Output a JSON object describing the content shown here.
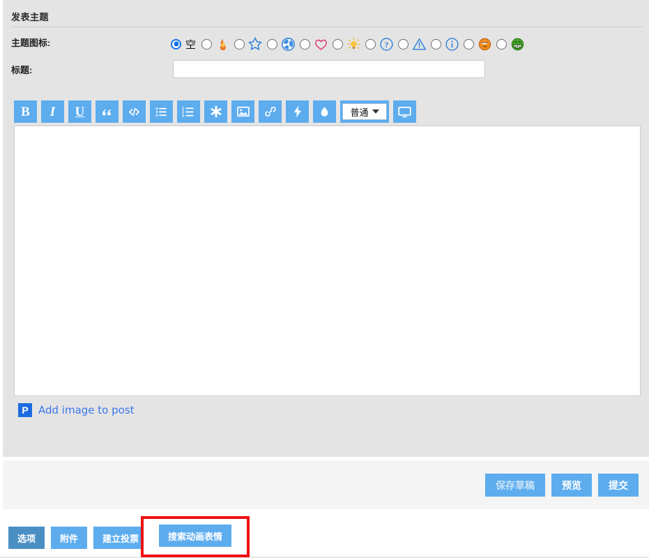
{
  "panel": {
    "title": "发表主题"
  },
  "fields": {
    "icon_label": "主题图标:",
    "title_label": "标题:",
    "title_value": "",
    "title_placeholder": ""
  },
  "topic_icons": [
    {
      "name": "none",
      "glyph": "空",
      "selected": true
    },
    {
      "name": "flame",
      "glyph": "flame-icon",
      "selected": false
    },
    {
      "name": "star",
      "glyph": "star-icon",
      "selected": false
    },
    {
      "name": "radioactive",
      "glyph": "radioactive-icon",
      "selected": false
    },
    {
      "name": "heart",
      "glyph": "heart-icon",
      "selected": false
    },
    {
      "name": "lightbulb",
      "glyph": "lightbulb-icon",
      "selected": false
    },
    {
      "name": "question",
      "glyph": "question-icon",
      "selected": false
    },
    {
      "name": "warning",
      "glyph": "warning-icon",
      "selected": false
    },
    {
      "name": "info",
      "glyph": "info-icon",
      "selected": false
    },
    {
      "name": "smiley-orange",
      "glyph": "smiley-orange-icon",
      "selected": false
    },
    {
      "name": "grin-green",
      "glyph": "grin-green-icon",
      "selected": false
    }
  ],
  "toolbar": {
    "buttons": [
      {
        "name": "bold",
        "label": "B",
        "style": "serif"
      },
      {
        "name": "italic",
        "label": "I",
        "style": "serif-i"
      },
      {
        "name": "underline",
        "label": "U",
        "style": "serif-u"
      },
      {
        "name": "quote",
        "label": "quote-icon",
        "style": "svg"
      },
      {
        "name": "code",
        "label": "code-icon",
        "style": "svg"
      },
      {
        "name": "bullet-list",
        "label": "bullet-list-icon",
        "style": "svg"
      },
      {
        "name": "numbered-list",
        "label": "numbered-list-icon",
        "style": "svg"
      },
      {
        "name": "asterisk",
        "label": "asterisk-icon",
        "style": "svg"
      },
      {
        "name": "image",
        "label": "image-icon",
        "style": "svg"
      },
      {
        "name": "link",
        "label": "link-icon",
        "style": "svg"
      },
      {
        "name": "lightning",
        "label": "lightning-icon",
        "style": "svg"
      },
      {
        "name": "droplet",
        "label": "droplet-icon",
        "style": "svg"
      }
    ],
    "font_select_value": "普通",
    "screen_button": "screen-icon"
  },
  "editor": {
    "content": ""
  },
  "add_image": {
    "icon": "postimage-p-icon",
    "icon_letter": "P",
    "label": "Add image to post"
  },
  "submit_bar": {
    "save_draft": "保存草稿",
    "preview": "预览",
    "submit": "提交"
  },
  "bottom_tabs": [
    {
      "label": "选项",
      "active": true
    },
    {
      "label": "附件",
      "active": false
    },
    {
      "label": "建立投票",
      "active": false
    }
  ],
  "highlighted_tab": {
    "label": "搜索动画表情",
    "highlight_color": "#ee1111"
  },
  "colors": {
    "accent": "#5cacee",
    "accent_dark": "#4a8fc4",
    "panel_bg": "#e4e4e4",
    "footer_bg": "#f4f4f4",
    "link": "#3a76e8",
    "highlight": "#ee1111"
  }
}
